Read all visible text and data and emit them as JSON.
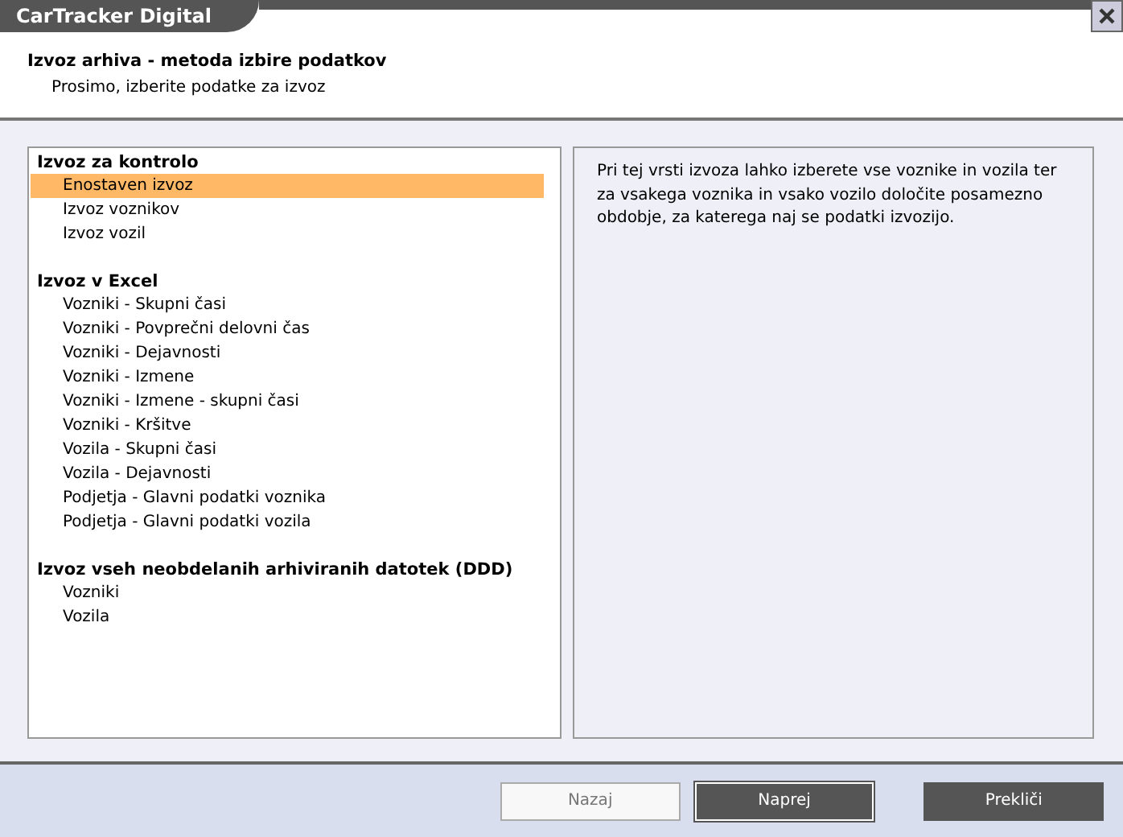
{
  "window": {
    "title": "CarTracker Digital"
  },
  "header": {
    "title": "Izvoz arhiva - metoda izbire podatkov",
    "subtitle": "Prosimo, izberite podatke za izvoz"
  },
  "groups": [
    {
      "title": "Izvoz za kontrolo",
      "items": [
        {
          "label": "Enostaven izvoz",
          "selected": true
        },
        {
          "label": "Izvoz voznikov",
          "selected": false
        },
        {
          "label": "Izvoz vozil",
          "selected": false
        }
      ]
    },
    {
      "title": "Izvoz v Excel",
      "items": [
        {
          "label": "Vozniki - Skupni časi",
          "selected": false
        },
        {
          "label": "Vozniki - Povprečni delovni čas",
          "selected": false
        },
        {
          "label": "Vozniki - Dejavnosti",
          "selected": false
        },
        {
          "label": "Vozniki - Izmene",
          "selected": false
        },
        {
          "label": "Vozniki - Izmene - skupni časi",
          "selected": false
        },
        {
          "label": "Vozniki - Kršitve",
          "selected": false
        },
        {
          "label": "Vozila - Skupni časi",
          "selected": false
        },
        {
          "label": "Vozila - Dejavnosti",
          "selected": false
        },
        {
          "label": "Podjetja - Glavni podatki voznika",
          "selected": false
        },
        {
          "label": "Podjetja - Glavni podatki vozila",
          "selected": false
        }
      ]
    },
    {
      "title": "Izvoz vseh neobdelanih arhiviranih datotek (DDD)",
      "items": [
        {
          "label": "Vozniki",
          "selected": false
        },
        {
          "label": "Vozila",
          "selected": false
        }
      ]
    }
  ],
  "description": "Pri tej vrsti izvoza lahko izberete vse voznike in vozila ter za vsakega voznika in vsako vozilo določite posamezno obdobje, za katerega naj se podatki izvozijo.",
  "buttons": [
    {
      "label": "Nazaj",
      "disabled": true,
      "focused": false
    },
    {
      "label": "Naprej",
      "disabled": false,
      "focused": true
    },
    {
      "label": "Prekliči",
      "disabled": false,
      "focused": false
    }
  ]
}
